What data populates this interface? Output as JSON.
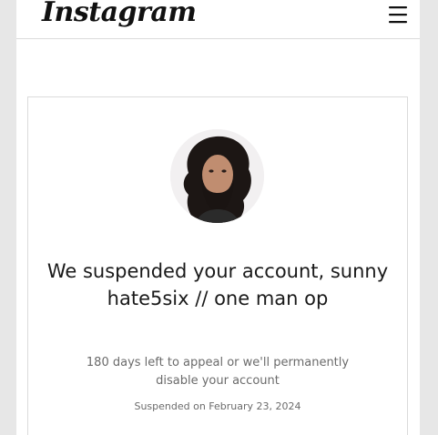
{
  "header": {
    "logo_text": "Instagram",
    "menu_icon": "hamburger-menu-icon"
  },
  "suspension": {
    "avatar_icon": "profile-photo",
    "title": "We suspended your account, sunny hate5six // one man op",
    "appeal_notice": "180 days left to appeal or we'll permanently disable your account",
    "suspended_on": "Suspended on February 23, 2024"
  },
  "colors": {
    "background": "#e7e7e7",
    "text_primary": "#1a1a1a",
    "text_secondary": "#6b6b6b",
    "border": "#dbdbdb"
  }
}
